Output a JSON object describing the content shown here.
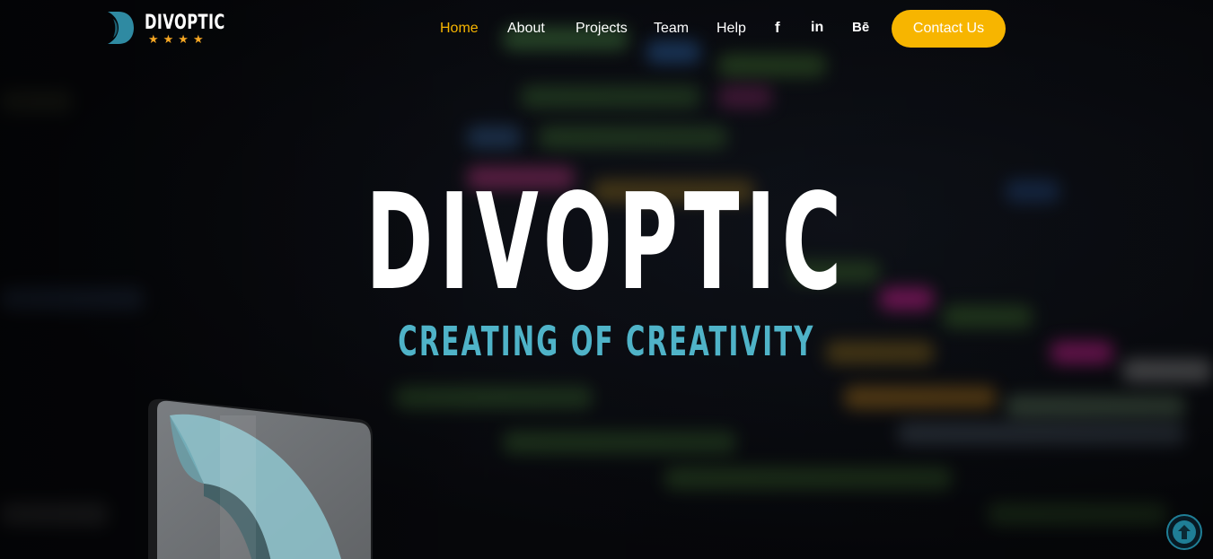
{
  "brand": {
    "name": "DIVOPTIC",
    "stars": "★★★★",
    "logo_icon": "d-logo-icon",
    "accent_color": "#f7b500",
    "teal_color": "#4fb3c8"
  },
  "nav": {
    "items": [
      {
        "label": "Home",
        "active": true
      },
      {
        "label": "About",
        "active": false
      },
      {
        "label": "Projects",
        "active": false
      },
      {
        "label": "Team",
        "active": false
      },
      {
        "label": "Help",
        "active": false
      }
    ],
    "social": [
      {
        "icon": "facebook-icon",
        "glyph": "f"
      },
      {
        "icon": "linkedin-icon",
        "glyph": "in"
      },
      {
        "icon": "behance-icon",
        "glyph": "Bē"
      }
    ],
    "contact_label": "Contact Us"
  },
  "hero": {
    "title": "DIVOPTIC",
    "tagline": "CREATING OF CREATIVITY"
  },
  "back_to_top": {
    "icon": "arrow-up-icon"
  }
}
